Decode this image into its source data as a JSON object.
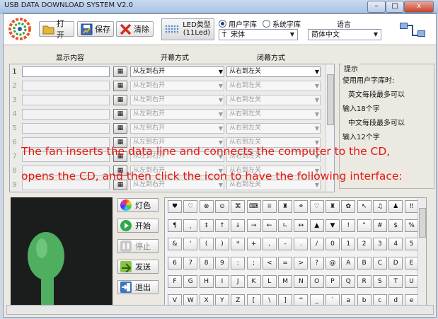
{
  "window": {
    "title": "USB DATA DOWNLOAD SYSTEM V2.0",
    "min": "–",
    "max": "□",
    "close": "x"
  },
  "toolbar": {
    "open": "打开",
    "save": "保存",
    "clear": "清除",
    "led_type": "LED类型",
    "led_value": "(11Led)"
  },
  "font": {
    "user_font": "用户字库",
    "system_font": "系统字库",
    "font_name": "宋体",
    "font_prefix": "Ť"
  },
  "language": {
    "label": "语言",
    "value": "简体中文"
  },
  "table": {
    "headers": {
      "content": "显示内容",
      "open_mode": "开幕方式",
      "close_mode": "闭幕方式"
    },
    "rows": [
      {
        "num": "1",
        "open": "从左到右开",
        "close": "从右到左关"
      },
      {
        "num": "2",
        "open": "从左到右开",
        "close": "从右到左关"
      },
      {
        "num": "3",
        "open": "从左到右开",
        "close": "从右到左关"
      },
      {
        "num": "4",
        "open": "从左到右开",
        "close": "从右到左关"
      },
      {
        "num": "5",
        "open": "从左到右开",
        "close": "从右到左关"
      },
      {
        "num": "6",
        "open": "从左到右开",
        "close": "从右到左关"
      },
      {
        "num": "7",
        "open": "从左到右开",
        "close": "从右到左关"
      },
      {
        "num": "8",
        "open": "从左到右开",
        "close": "从右到左关"
      },
      {
        "num": "9",
        "open": "从左到右开",
        "close": "从右到左关"
      }
    ]
  },
  "tips": {
    "title": "提示",
    "l1": "使用用户字库时:",
    "l2": "英文每段最多可以",
    "l3": "输入18个字",
    "l4": "中文每段最多可以",
    "l5": "输入12个字"
  },
  "controls": {
    "color": "灯色",
    "start": "开始",
    "stop": "停止",
    "send": "发送",
    "exit": "退出"
  },
  "keys": [
    [
      "♥",
      "♡",
      "⊗",
      "⊙",
      "⌘",
      "⌨",
      "♕",
      "♜",
      "⚭",
      "♡",
      "♜",
      "✿",
      "↖",
      "♫",
      "♟",
      "‼"
    ],
    [
      "¶",
      "¸",
      "‡",
      "↑",
      "↓",
      "→",
      "←",
      "∟",
      "↔",
      "▲",
      "▼",
      "!",
      "\"",
      "#",
      "$",
      "%"
    ],
    [
      "&",
      "'",
      "(",
      ")",
      "*",
      "+",
      ",",
      "-",
      ".",
      "/",
      "0",
      "1",
      "2",
      "3",
      "4",
      "5"
    ],
    [
      "6",
      "7",
      "8",
      "9",
      ":",
      ";",
      "<",
      "=",
      ">",
      "?",
      "@",
      "A",
      "B",
      "C",
      "D",
      "E"
    ],
    [
      "F",
      "G",
      "H",
      "I",
      "J",
      "K",
      "L",
      "M",
      "N",
      "O",
      "P",
      "Q",
      "R",
      "S",
      "T",
      "U"
    ],
    [
      "V",
      "W",
      "X",
      "Y",
      "Z",
      "[",
      "\\",
      "]",
      "^",
      "_",
      "`",
      "a",
      "b",
      "c",
      "d",
      "e"
    ]
  ],
  "overlay": {
    "line1": "The fan inserts the data line and connects the computer to the CD,",
    "line2": "opens the CD, and then click the icon to have the following interface:"
  },
  "colors": {
    "overlay_text": "#e8170e",
    "preview_bg": "#1a1d1c",
    "fan_green": "#4fae5f"
  }
}
